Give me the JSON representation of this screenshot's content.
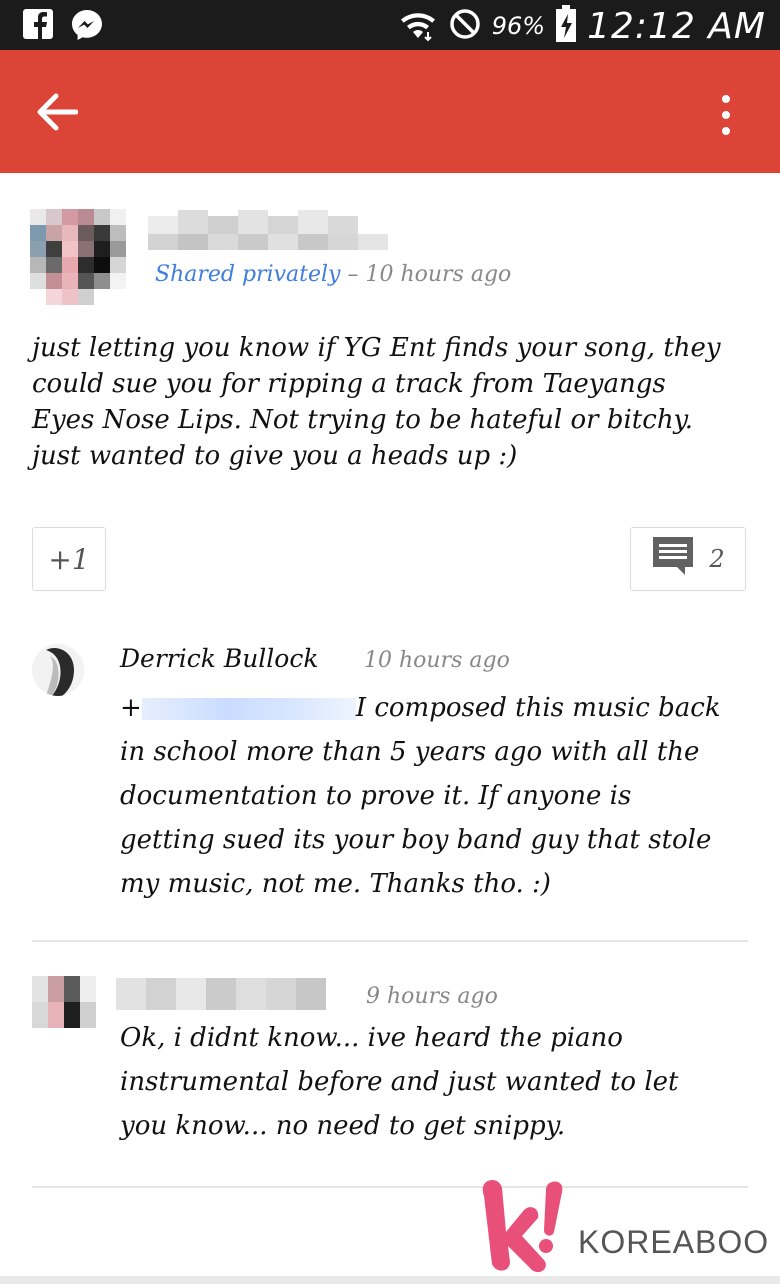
{
  "status_bar": {
    "battery": "96%",
    "time": "12:12 AM",
    "icons": [
      "facebook-icon",
      "messenger-icon",
      "wifi-icon",
      "do-not-disturb-icon",
      "battery-charging-icon"
    ]
  },
  "app_bar": {
    "color": "#db4437",
    "icons": [
      "back-arrow-icon",
      "more-vert-icon"
    ]
  },
  "post": {
    "visibility": "Shared privately",
    "separator": " – ",
    "time": "10 hours ago",
    "lines": [
      "just letting you know if YG Ent finds your song, they",
      "could sue you for ripping a track from Taeyangs",
      "Eyes Nose Lips. Not trying to be hateful or bitchy.",
      "just wanted to give you a heads up :)"
    ],
    "plus_one_label": "+1",
    "comment_count": "2"
  },
  "comments": [
    {
      "author": "Derrick Bullock",
      "time": "10 hours ago",
      "mention_prefix": "+",
      "first_line_rest": "I composed this music back",
      "lines": [
        "in school more than 5 years ago with all the",
        "documentation to prove it. If anyone is",
        "getting sued its your boy band guy that stole",
        "my music, not me. Thanks tho. :)"
      ]
    },
    {
      "author": "",
      "time": "9 hours ago",
      "lines": [
        "Ok, i didnt know... ive heard the piano",
        "instrumental before and just wanted to let",
        "you know... no need to get snippy."
      ]
    }
  ],
  "watermark": {
    "text": "KOREABOO",
    "color": "#e8507a"
  }
}
